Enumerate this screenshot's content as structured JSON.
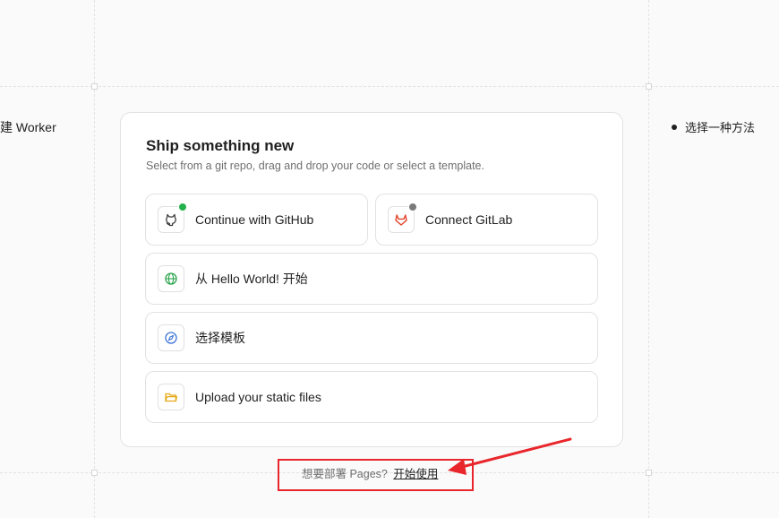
{
  "steps": {
    "left_label": "建 Worker",
    "right_label": "选择一种方法"
  },
  "card": {
    "title": "Ship something new",
    "subtitle": "Select from a git repo, drag and drop your code or select a template.",
    "options": {
      "github": {
        "label": "Continue with GitHub",
        "icon": "github-icon",
        "status_color": "#22b14c"
      },
      "gitlab": {
        "label": "Connect GitLab",
        "icon": "gitlab-icon",
        "status_color": "#7a7a7a"
      },
      "hello_world": {
        "label": "从 Hello World! 开始",
        "icon": "globe-icon"
      },
      "template": {
        "label": "选择模板",
        "icon": "compass-icon"
      },
      "upload": {
        "label": "Upload your static files",
        "icon": "folder-icon"
      }
    }
  },
  "footer": {
    "question": "想要部署 Pages?",
    "link_label": "开始使用"
  },
  "colors": {
    "annotation": "#e8262b",
    "github_icon": "#3b3b3b",
    "gitlab_icon": "#e24329",
    "globe_icon": "#2da44e",
    "compass_icon": "#3b73d9",
    "folder_icon": "#e6a817"
  }
}
